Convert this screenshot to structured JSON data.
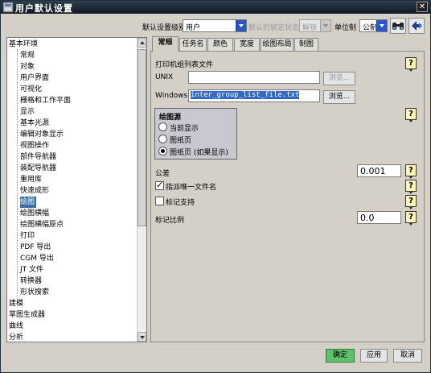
{
  "window": {
    "title": "用户默认设置"
  },
  "header": {
    "level_label": "默认设置级别",
    "level_value": "用户",
    "lock_label": "默认的锁定状态",
    "lock_value": "解锁",
    "unit_label": "单位制",
    "unit_value": "公制"
  },
  "tree": {
    "items": [
      {
        "label": "基本环境",
        "indent": 0,
        "selected": false
      },
      {
        "label": "常规",
        "indent": 1,
        "selected": false
      },
      {
        "label": "对象",
        "indent": 1,
        "selected": false
      },
      {
        "label": "用户界面",
        "indent": 1,
        "selected": false
      },
      {
        "label": "可视化",
        "indent": 1,
        "selected": false
      },
      {
        "label": "栅格和工作平面",
        "indent": 1,
        "selected": false
      },
      {
        "label": "显示",
        "indent": 1,
        "selected": false
      },
      {
        "label": "基本光源",
        "indent": 1,
        "selected": false
      },
      {
        "label": "编辑对象显示",
        "indent": 1,
        "selected": false
      },
      {
        "label": "视图操作",
        "indent": 1,
        "selected": false
      },
      {
        "label": "部件导航器",
        "indent": 1,
        "selected": false
      },
      {
        "label": "装配导航器",
        "indent": 1,
        "selected": false
      },
      {
        "label": "重用库",
        "indent": 1,
        "selected": false
      },
      {
        "label": "快速成形",
        "indent": 1,
        "selected": false
      },
      {
        "label": "绘图",
        "indent": 1,
        "selected": true
      },
      {
        "label": "绘图横幅",
        "indent": 1,
        "selected": false
      },
      {
        "label": "绘图横幅原点",
        "indent": 1,
        "selected": false
      },
      {
        "label": "打印",
        "indent": 1,
        "selected": false
      },
      {
        "label": "PDF 导出",
        "indent": 1,
        "selected": false
      },
      {
        "label": "CGM 导出",
        "indent": 1,
        "selected": false
      },
      {
        "label": "JT 文件",
        "indent": 1,
        "selected": false
      },
      {
        "label": "转换器",
        "indent": 1,
        "selected": false
      },
      {
        "label": "形状搜索",
        "indent": 1,
        "selected": false
      },
      {
        "label": "建模",
        "indent": 0,
        "selected": false
      },
      {
        "label": "草图生成器",
        "indent": 0,
        "selected": false
      },
      {
        "label": "曲线",
        "indent": 0,
        "selected": false
      },
      {
        "label": "分析",
        "indent": 0,
        "selected": false
      }
    ]
  },
  "tabs": [
    {
      "label": "常规",
      "active": true
    },
    {
      "label": "任务名",
      "active": false
    },
    {
      "label": "颜色",
      "active": false
    },
    {
      "label": "宽度",
      "active": false
    },
    {
      "label": "绘图布局",
      "active": false
    },
    {
      "label": "制图",
      "active": false
    }
  ],
  "panel": {
    "printer_list_label": "打印机组列表文件",
    "unix_label": "UNIX",
    "unix_value": "",
    "browse_label": "浏览...",
    "windows_label": "Windows",
    "windows_value": "inter_group_list_file.txt",
    "source_group_title": "绘图源",
    "source_options": [
      {
        "label": "当前显示",
        "selected": false
      },
      {
        "label": "图纸页",
        "selected": false
      },
      {
        "label": "图纸页 (如果显示)",
        "selected": true
      }
    ],
    "tolerance_label": "公差",
    "tolerance_value": "0.001",
    "assign_unique_label": "指派唯一文件名",
    "assign_unique_checked": true,
    "mark_support_label": "标记支持",
    "mark_support_checked": false,
    "mark_scale_label": "标记比例",
    "mark_scale_value": "0.0",
    "help_glyph": "?"
  },
  "footer": {
    "ok_label": "确定",
    "apply_label": "应用",
    "cancel_label": "取消"
  }
}
